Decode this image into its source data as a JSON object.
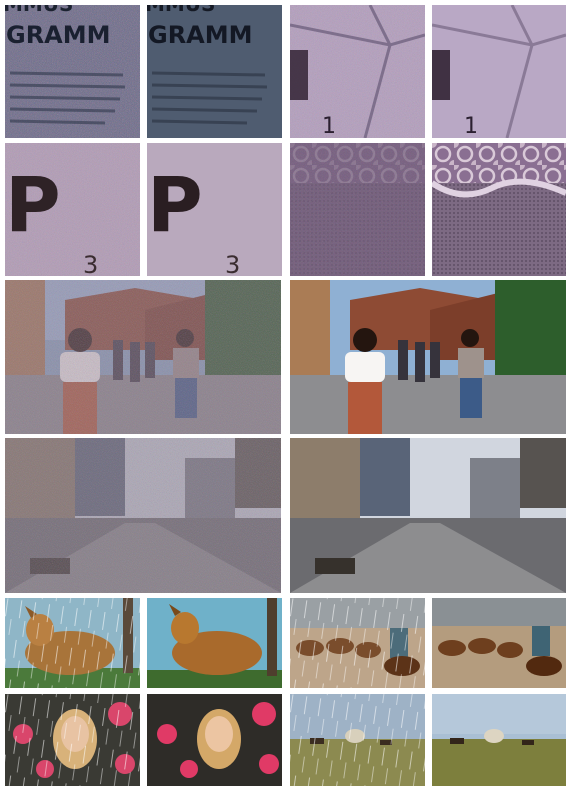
{
  "grid": {
    "rows": 6,
    "tiles": [
      {
        "id": "tile-r1c1",
        "variant": "noisy",
        "scene": "document-close-up",
        "text": "GRAMM"
      },
      {
        "id": "tile-r1c2",
        "variant": "denoised",
        "scene": "document-close-up",
        "text": "GRAMM"
      },
      {
        "id": "tile-r1c3",
        "variant": "noisy",
        "scene": "tiles-digit",
        "text": "1"
      },
      {
        "id": "tile-r1c4",
        "variant": "denoised",
        "scene": "tiles-digit",
        "text": "1"
      },
      {
        "id": "tile-r2c1",
        "variant": "noisy",
        "scene": "letter-tile",
        "text": "P",
        "subscript": "3"
      },
      {
        "id": "tile-r2c2",
        "variant": "denoised",
        "scene": "letter-tile",
        "text": "P",
        "subscript": "3"
      },
      {
        "id": "tile-r2c3",
        "variant": "noisy",
        "scene": "lace-fabric"
      },
      {
        "id": "tile-r2c4",
        "variant": "denoised",
        "scene": "lace-fabric"
      },
      {
        "id": "tile-r3c1",
        "variant": "noisy",
        "scene": "street-palace-people"
      },
      {
        "id": "tile-r3c2",
        "variant": "denoised",
        "scene": "street-palace-people"
      },
      {
        "id": "tile-r4c1",
        "variant": "noisy",
        "scene": "city-boulevard"
      },
      {
        "id": "tile-r4c2",
        "variant": "denoised",
        "scene": "city-boulevard"
      },
      {
        "id": "tile-r5c1",
        "variant": "rain",
        "scene": "collie-dog"
      },
      {
        "id": "tile-r5c2",
        "variant": "clean",
        "scene": "collie-dog"
      },
      {
        "id": "tile-r5c3",
        "variant": "rain",
        "scene": "cattle-rider"
      },
      {
        "id": "tile-r5c4",
        "variant": "clean",
        "scene": "cattle-rider"
      },
      {
        "id": "tile-r6c1",
        "variant": "rain",
        "scene": "girl-flowers"
      },
      {
        "id": "tile-r6c2",
        "variant": "clean",
        "scene": "girl-flowers"
      },
      {
        "id": "tile-r6c3",
        "variant": "rain",
        "scene": "wagon-prairie"
      },
      {
        "id": "tile-r6c4",
        "variant": "clean",
        "scene": "wagon-prairie"
      }
    ]
  },
  "texts": {
    "doc_word": "GRAMM",
    "doc_word_top": "MMUS",
    "digit": "1",
    "letter": "P",
    "letter_sub": "3"
  }
}
